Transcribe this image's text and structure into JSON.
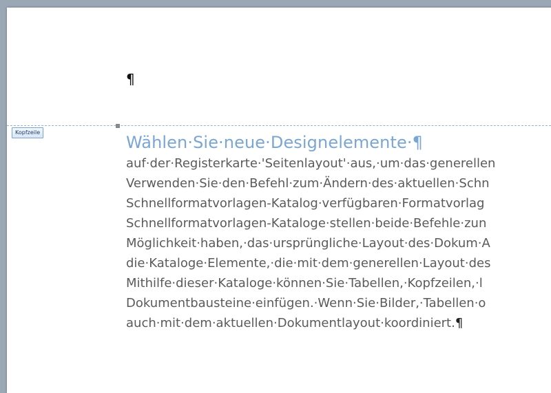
{
  "header": {
    "pilcrow": "¶",
    "tab_label": "Kopfzeile"
  },
  "body": {
    "heading": "Wählen·Sie·neue·Designelemente·",
    "heading_mark": "¶",
    "lines": [
      "auf·der·Registerkarte·'Seitenlayout'·aus,·um·das·generellen",
      "Verwenden·Sie·den·Befehl·zum·Ändern·des·aktuellen·Schn",
      "Schnellformatvorlagen-Katalog·verfügbaren·Formatvorlag",
      "Schnellformatvorlagen-Kataloge·stellen·beide·Befehle·zun",
      "Möglichkeit·haben,·das·ursprüngliche·Layout·des·Dokum·A",
      "die·Kataloge·Elemente,·die·mit·dem·generellen·Layout·des",
      "Mithilfe·dieser·Kataloge·können·Sie·Tabellen,·Kopfzeilen,·l",
      "Dokumentbausteine·einfügen.·Wenn·Sie·Bilder,·Tabellen·o",
      "auch·mit·dem·aktuellen·Dokumentlayout·koordiniert."
    ],
    "end_mark": "¶"
  },
  "colors": {
    "heading": "#7aa6d4",
    "body_text": "#5a5a5a",
    "separator": "#8fb3d9"
  }
}
